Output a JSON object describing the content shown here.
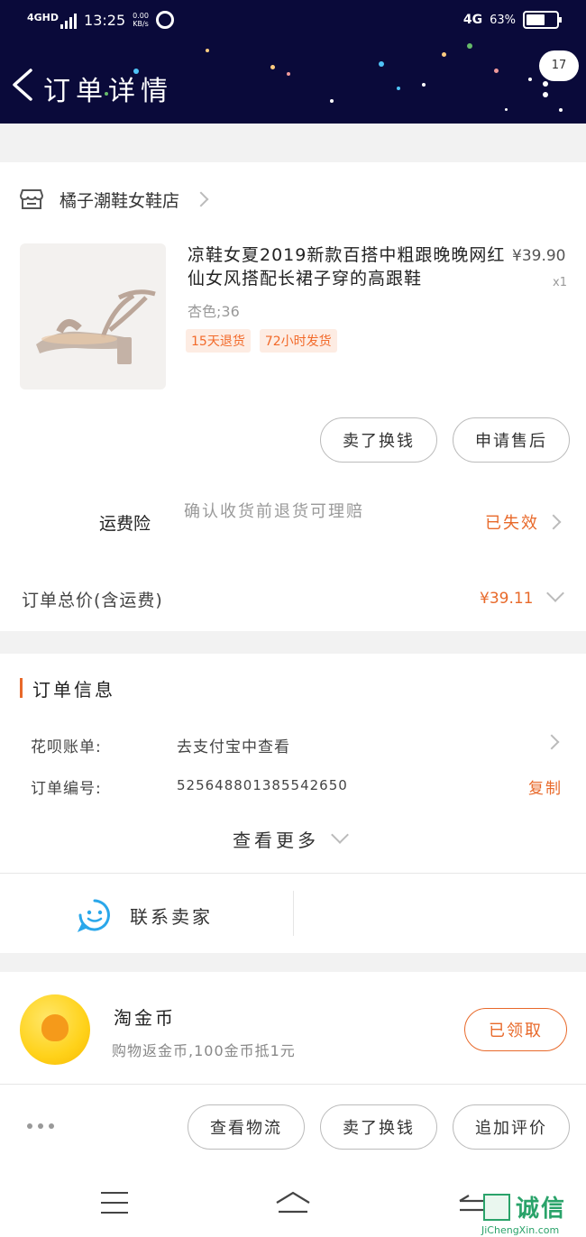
{
  "status_bar": {
    "network": "4GHD",
    "time": "13:25",
    "speed_value": "0.00",
    "speed_unit": "KB/s",
    "right_network": "4G",
    "battery_pct": "63%",
    "battery_level": 0.63
  },
  "nav": {
    "title": "订单详情",
    "message_count": "17"
  },
  "shop": {
    "name": "橘子潮鞋女鞋店"
  },
  "product": {
    "title": "凉鞋女夏2019新款百搭中粗跟晚晚网红仙女风搭配长裙子穿的高跟鞋",
    "price": "¥39.90",
    "qty": "x1",
    "spec": "杏色;36",
    "tags": [
      "15天退货",
      "72小时发货"
    ]
  },
  "item_actions": {
    "sell_label": "卖了换钱",
    "aftersale_label": "申请售后"
  },
  "insurance": {
    "label": "运费险",
    "desc": "确认收货前退货可理赔",
    "status": "已失效"
  },
  "total": {
    "label": "订单总价(含运费)",
    "value": "¥39.11"
  },
  "order_info": {
    "title": "订单信息",
    "huabei_label": "花呗账单:",
    "huabei_value": "去支付宝中查看",
    "order_no_label": "订单编号:",
    "order_no_value": "525648801385542650",
    "copy_label": "复制",
    "more_label": "查看更多"
  },
  "contact": {
    "label": "联系卖家"
  },
  "coins": {
    "title": "淘金币",
    "desc": "购物返金币,100金币抵1元",
    "button": "已领取"
  },
  "bottom_actions": {
    "logistics": "查看物流",
    "sell": "卖了换钱",
    "review": "追加评价"
  },
  "watermark": {
    "text": "诚信",
    "sub": "JiChengXin.com"
  },
  "colors": {
    "header_bg": "#0a0a3a",
    "accent": "#e8692a",
    "contact_blue": "#2aa7ea"
  }
}
